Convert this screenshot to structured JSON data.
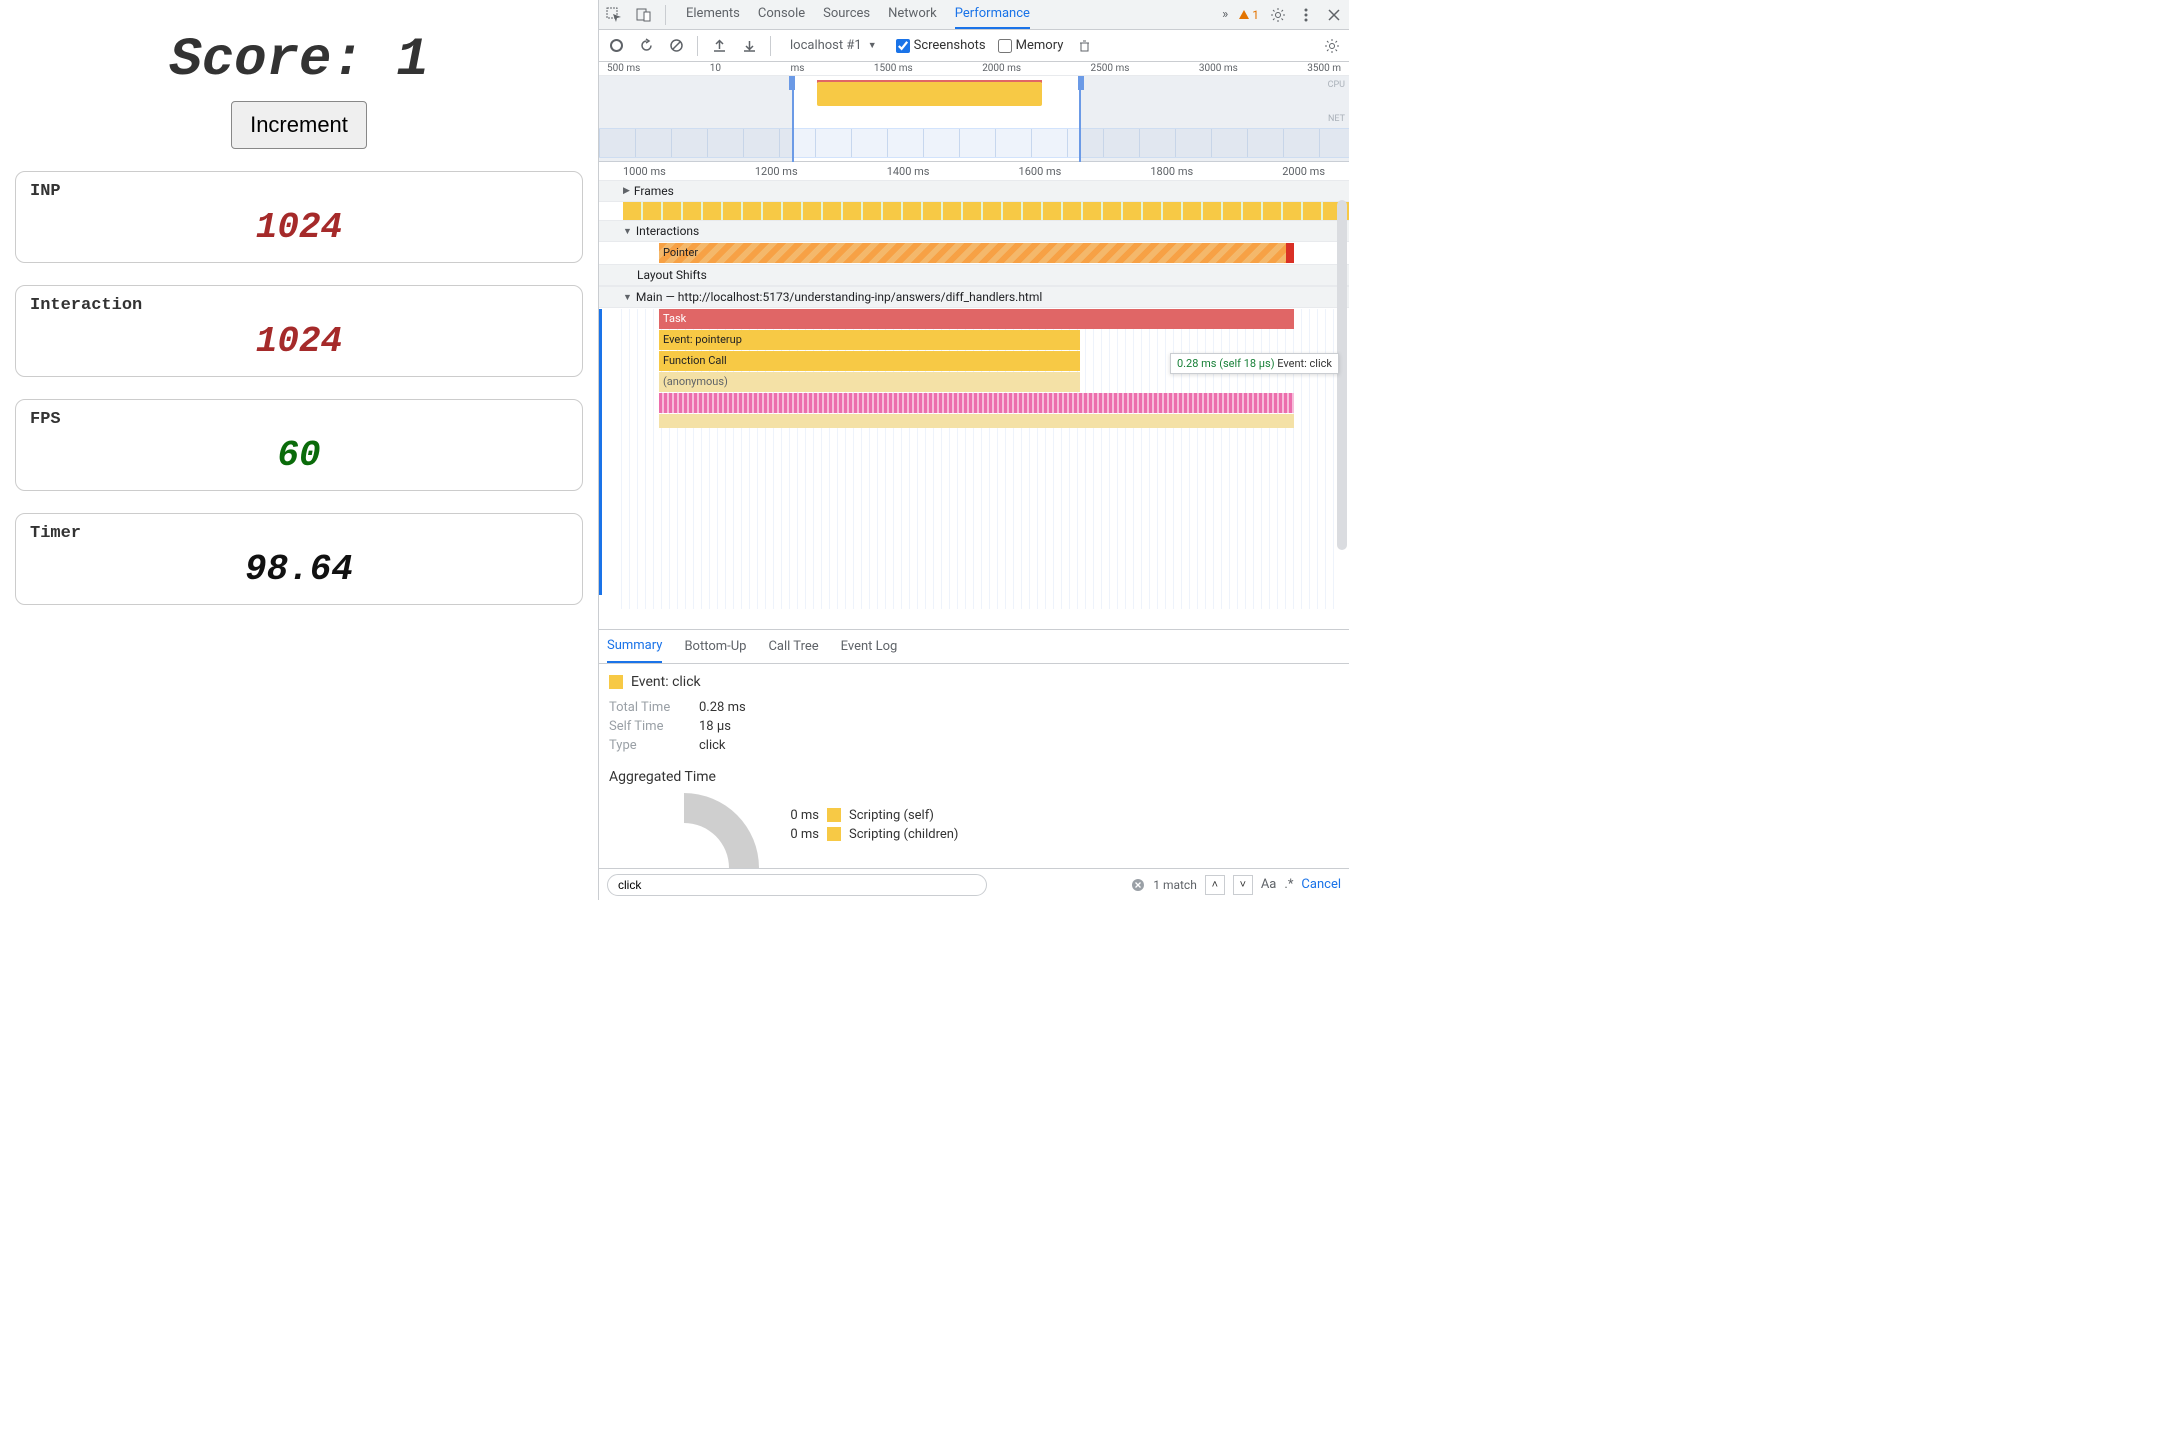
{
  "page": {
    "score_prefix": "Score: ",
    "score_value": "1",
    "increment_label": "Increment",
    "metrics": [
      {
        "label": "INP",
        "value": "1024",
        "color": "red"
      },
      {
        "label": "Interaction",
        "value": "1024",
        "color": "red"
      },
      {
        "label": "FPS",
        "value": "60",
        "color": "green"
      },
      {
        "label": "Timer",
        "value": "98.64",
        "color": "black"
      }
    ]
  },
  "devtools": {
    "tabs": [
      "Elements",
      "Console",
      "Sources",
      "Network",
      "Performance"
    ],
    "active_tab": "Performance",
    "more_glyph": "»",
    "warnings_count": "1",
    "toolbar": {
      "dropdown": "localhost #1",
      "screenshots_label": "Screenshots",
      "screenshots_checked": true,
      "memory_label": "Memory",
      "memory_checked": false
    },
    "overview": {
      "ticks": [
        "500 ms",
        "10",
        "ms",
        "1500 ms",
        "2000 ms",
        "2500 ms",
        "3000 ms",
        "3500 m"
      ],
      "cpu_label": "CPU",
      "net_label": "NET"
    },
    "flame": {
      "ruler": [
        "1000 ms",
        "1200 ms",
        "1400 ms",
        "1600 ms",
        "1800 ms",
        "2000 ms"
      ],
      "frames_label": "Frames",
      "interactions_label": "Interactions",
      "pointer_label": "Pointer",
      "layout_shifts_label": "Layout Shifts",
      "main_label": "Main — http://localhost:5173/understanding-inp/answers/diff_handlers.html",
      "rows": {
        "task": "Task",
        "event_pointerup": "Event: pointerup",
        "function_call": "Function Call",
        "anonymous": "(anonymous)"
      },
      "tooltip_time": "0.28 ms (self 18 μs)",
      "tooltip_event": "Event: click"
    },
    "details": {
      "tabs": [
        "Summary",
        "Bottom-Up",
        "Call Tree",
        "Event Log"
      ],
      "active": "Summary",
      "event_title": "Event: click",
      "total_time_k": "Total Time",
      "total_time_v": "0.28 ms",
      "self_time_k": "Self Time",
      "self_time_v": "18 μs",
      "type_k": "Type",
      "type_v": "click",
      "agg_title": "Aggregated Time",
      "agg_items": [
        {
          "time": "0 ms",
          "label": "Scripting (self)"
        },
        {
          "time": "0 ms",
          "label": "Scripting (children)"
        }
      ]
    },
    "search": {
      "value": "click",
      "matches": "1 match",
      "cancel": "Cancel",
      "aa": "Aa",
      "regex": ".*"
    }
  }
}
